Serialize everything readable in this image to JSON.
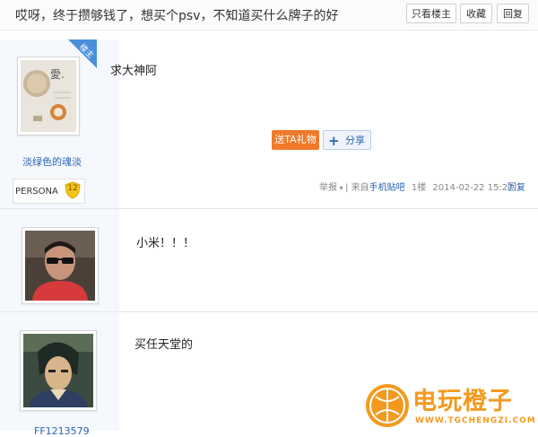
{
  "header": {
    "title": "哎呀，终于攒够钱了，想买个psv，不知道买什么牌子的好",
    "buttons": {
      "only_op": "只看楼主",
      "favorite": "收藏",
      "reply": "回复"
    }
  },
  "posts": [
    {
      "username": "淡绿色的魂淡",
      "badge": "楼主",
      "level_label": "PERSONA",
      "level": "12",
      "content": "求大神阿",
      "gift_label": "送TA礼物",
      "share_label": "分享",
      "report": "举报",
      "source_prefix": "| 来自",
      "source": "手机贴吧",
      "floor": "1楼",
      "time": "2014-02-22 15:27",
      "reply": "回复"
    },
    {
      "content": "小米！！！"
    },
    {
      "content": "买任天堂的",
      "username": "FF1213579"
    }
  ],
  "watermark": {
    "name": "电玩橙子",
    "url": "WWW.TGCHENGZI.COM"
  },
  "colors": {
    "accent": "#f07a2b",
    "link": "#2d64b3",
    "badge": "#4a8fdc"
  }
}
